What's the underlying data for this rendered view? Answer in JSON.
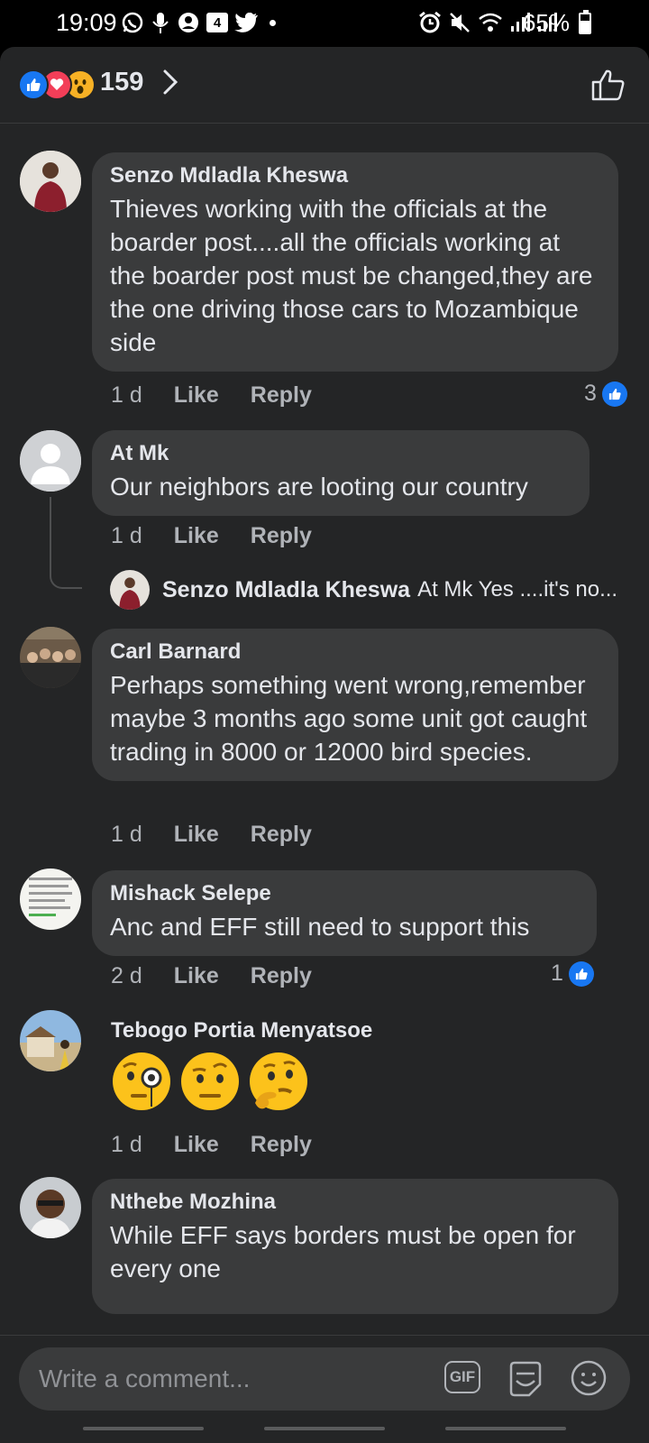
{
  "status_bar": {
    "time": "19:09",
    "battery": "65%",
    "battery_level": 0.65,
    "notification_badge": "4"
  },
  "header": {
    "reaction_count": "159",
    "reactions": [
      "like-icon",
      "love-icon",
      "wow-icon"
    ]
  },
  "comments": [
    {
      "author": "Senzo Mdladla Kheswa",
      "text": "Thieves working with the officials at the boarder post....all the officials working at the boarder post must be changed,they are the one driving those cars to Mozambique side",
      "time": "1 d",
      "like": "Like",
      "reply": "Reply",
      "reactions": "3"
    },
    {
      "author": "At Mk",
      "text": "Our neighbors are looting our country",
      "time": "1 d",
      "like": "Like",
      "reply": "Reply",
      "reply_preview": {
        "author": "Senzo Mdladla Kheswa",
        "text": "At Mk  Yes ....it's no..."
      }
    },
    {
      "author": "Carl Barnard",
      "text": "Perhaps something went wrong,remember maybe 3 months ago some unit got caught trading in 8000 or 12000 bird species.",
      "time": "1 d",
      "like": "Like",
      "reply": "Reply"
    },
    {
      "author": "Mishack Selepe",
      "text": "Anc and EFF still need to support this",
      "time": "2 d",
      "like": "Like",
      "reply": "Reply",
      "reactions": "1"
    },
    {
      "author": "Tebogo Portia Menyatsoe",
      "emojis": [
        "face-with-monocle",
        "face-with-raised-eyebrow",
        "thinking-face"
      ],
      "time": "1 d",
      "like": "Like",
      "reply": "Reply"
    },
    {
      "author": "Nthebe Mozhina",
      "text": "While EFF says borders must be open for every one"
    }
  ],
  "composer": {
    "placeholder": "Write a comment...",
    "gif_label": "GIF"
  },
  "colors": {
    "background": "#242526",
    "bubble": "#3a3b3c",
    "accent": "#1877f2",
    "text": "#e4e6eb",
    "muted": "#b0b3b8"
  }
}
